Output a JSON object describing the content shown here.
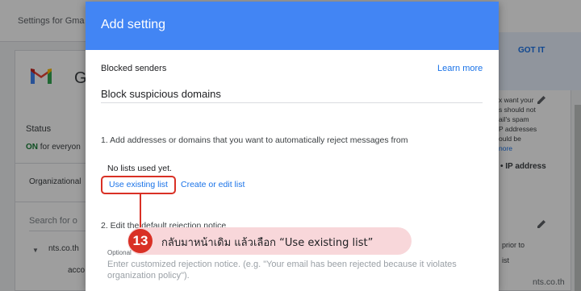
{
  "background": {
    "top_title": "Settings for Gma",
    "app_letter": "G",
    "status_label": "Status",
    "status_on": "ON",
    "status_rest": " for everyon",
    "org_label": "Organizational",
    "search_placeholder": "Search for o",
    "tree_item": "nts.co.th",
    "tree_sub": "acco",
    "got_it": "GOT IT",
    "right_text_lines": [
      "x want your",
      "s should not",
      "ail's spam",
      "P addresses",
      "ould be"
    ],
    "right_link": "nore",
    "right_ip": "• IP address",
    "right_prior": "prior to",
    "right_ist": "ist"
  },
  "dialog": {
    "title": "Add setting",
    "field_label": "Blocked senders",
    "learn_more": "Learn more",
    "name_value": "Block suspicious domains",
    "step1_text": "1. Add addresses or domains that you want to automatically reject messages from",
    "no_lists": "No lists used yet.",
    "use_existing": "Use existing list",
    "create_edit": "Create or edit list",
    "step2_text": "2. Edit the default rejection notice",
    "optional_label": "Optional",
    "textarea_placeholder": "Enter customized rejection notice. (e.g. \"Your email has been rejected because it violates organization policy\")."
  },
  "annotation": {
    "step_number": "13",
    "instruction": "กลับมาหน้าเดิม แล้วเลือก “Use existing list”"
  },
  "watermark": "nts.co.th",
  "colors": {
    "header_blue": "#4285f4",
    "link_blue": "#1a73e8",
    "highlight_red": "#d93025",
    "callout_pink": "#f8d7da"
  }
}
